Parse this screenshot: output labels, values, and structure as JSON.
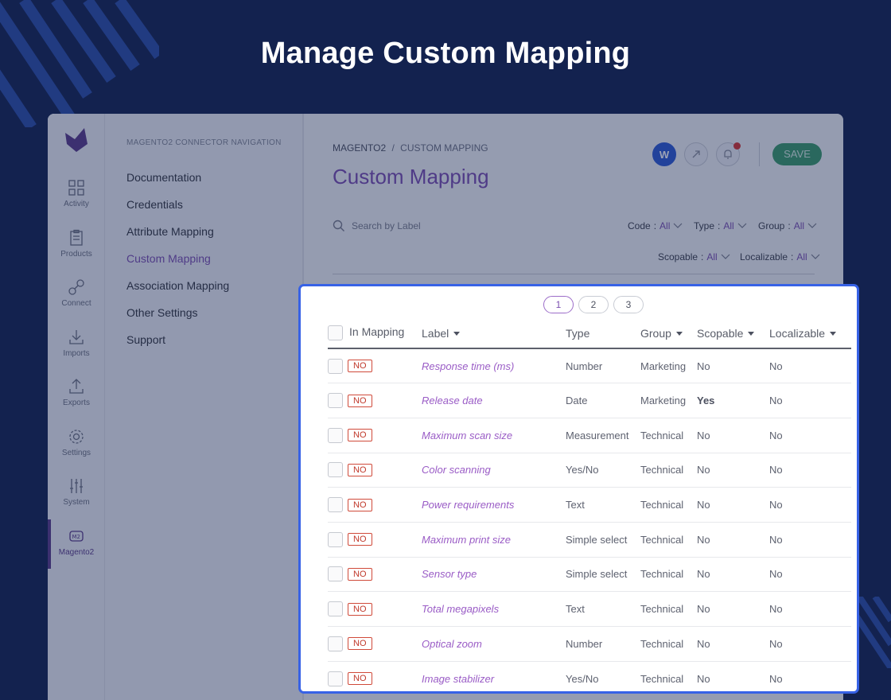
{
  "hero": {
    "title": "Manage Custom Mapping"
  },
  "iconbar": {
    "items": [
      {
        "label": "Activity",
        "icon": "grid-icon"
      },
      {
        "label": "Products",
        "icon": "clipboard-icon"
      },
      {
        "label": "Connect",
        "icon": "link-icon"
      },
      {
        "label": "Imports",
        "icon": "download-icon"
      },
      {
        "label": "Exports",
        "icon": "upload-icon"
      },
      {
        "label": "Settings",
        "icon": "gear-icon"
      },
      {
        "label": "System",
        "icon": "sliders-icon"
      },
      {
        "label": "Magento2",
        "icon": "magento-icon"
      }
    ]
  },
  "nav": {
    "heading": "MAGENTO2 CONNECTOR NAVIGATION",
    "items": [
      {
        "label": "Documentation"
      },
      {
        "label": "Credentials"
      },
      {
        "label": "Attribute Mapping"
      },
      {
        "label": "Custom Mapping"
      },
      {
        "label": "Association Mapping"
      },
      {
        "label": "Other Settings"
      },
      {
        "label": "Support"
      }
    ],
    "active": "Custom Mapping"
  },
  "header": {
    "breadcrumb_root": "MAGENTO2",
    "breadcrumb_sep": "/",
    "breadcrumb_current": "CUSTOM MAPPING",
    "title": "Custom Mapping",
    "save_label": "SAVE",
    "w_icon_label": "W"
  },
  "search": {
    "placeholder": "Search by Label"
  },
  "filters": [
    {
      "name": "Code",
      "value": "All"
    },
    {
      "name": "Type",
      "value": "All"
    },
    {
      "name": "Group",
      "value": "All"
    },
    {
      "name": "Scopable",
      "value": "All"
    },
    {
      "name": "Localizable",
      "value": "All"
    }
  ],
  "pagination": {
    "pages": [
      "1",
      "2",
      "3"
    ],
    "current": "1"
  },
  "table": {
    "columns": [
      "In Mapping",
      "Label",
      "Type",
      "Group",
      "Scopable",
      "Localizable"
    ],
    "no_badge": "NO",
    "rows": [
      {
        "label": "Response time (ms)",
        "type": "Number",
        "group": "Marketing",
        "scopable": "No",
        "localizable": "No"
      },
      {
        "label": "Release date",
        "type": "Date",
        "group": "Marketing",
        "scopable": "Yes",
        "localizable": "No"
      },
      {
        "label": "Maximum scan size",
        "type": "Measurement",
        "group": "Technical",
        "scopable": "No",
        "localizable": "No"
      },
      {
        "label": "Color scanning",
        "type": "Yes/No",
        "group": "Technical",
        "scopable": "No",
        "localizable": "No"
      },
      {
        "label": "Power requirements",
        "type": "Text",
        "group": "Technical",
        "scopable": "No",
        "localizable": "No"
      },
      {
        "label": "Maximum print size",
        "type": "Simple select",
        "group": "Technical",
        "scopable": "No",
        "localizable": "No"
      },
      {
        "label": "Sensor type",
        "type": "Simple select",
        "group": "Technical",
        "scopable": "No",
        "localizable": "No"
      },
      {
        "label": "Total megapixels",
        "type": "Text",
        "group": "Technical",
        "scopable": "No",
        "localizable": "No"
      },
      {
        "label": "Optical zoom",
        "type": "Number",
        "group": "Technical",
        "scopable": "No",
        "localizable": "No"
      },
      {
        "label": "Image stabilizer",
        "type": "Yes/No",
        "group": "Technical",
        "scopable": "No",
        "localizable": "No"
      }
    ]
  },
  "colors": {
    "background": "#13224f",
    "accent": "#7b4fb0",
    "highlight_border": "#3762e6",
    "save": "#3b9c69"
  }
}
